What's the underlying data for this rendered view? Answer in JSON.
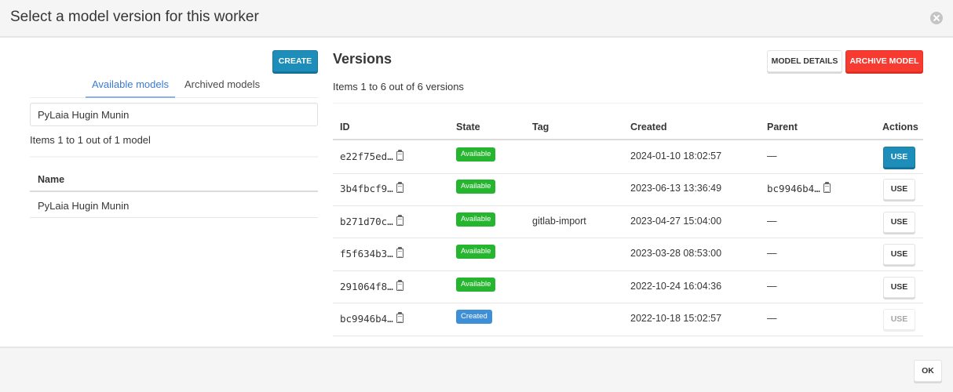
{
  "modal": {
    "title": "Select a model version for this worker",
    "close_icon": "close-circle-icon",
    "ok_label": "OK"
  },
  "left": {
    "create_label": "CREATE",
    "tabs": [
      {
        "label": "Available models",
        "active": true
      },
      {
        "label": "Archived models",
        "active": false
      }
    ],
    "search": {
      "value": "PyLaia Hugin Munin",
      "placeholder": ""
    },
    "count_text": "Items 1 to 1 out of 1 model",
    "table": {
      "header": "Name",
      "rows": [
        {
          "name": "PyLaia Hugin Munin"
        }
      ]
    }
  },
  "right": {
    "title": "Versions",
    "model_details_label": "MODEL DETAILS",
    "archive_model_label": "ARCHIVE MODEL",
    "count_text": "Items 1 to 6 out of 6 versions",
    "columns": [
      "ID",
      "State",
      "Tag",
      "Created",
      "Parent",
      "Actions"
    ],
    "rows": [
      {
        "id": "e22f75ed…",
        "state": "Available",
        "tag": "",
        "created": "2024-01-10 18:02:57",
        "parent": "—",
        "parent_copyable": false,
        "action": "USE",
        "action_style": "primary"
      },
      {
        "id": "3b4fbcf9…",
        "state": "Available",
        "tag": "",
        "created": "2023-06-13 13:36:49",
        "parent": "bc9946b4…",
        "parent_copyable": true,
        "action": "USE",
        "action_style": "default"
      },
      {
        "id": "b271d70c…",
        "state": "Available",
        "tag": "gitlab-import",
        "created": "2023-04-27 15:04:00",
        "parent": "—",
        "parent_copyable": false,
        "action": "USE",
        "action_style": "default"
      },
      {
        "id": "f5f634b3…",
        "state": "Available",
        "tag": "",
        "created": "2023-03-28 08:53:00",
        "parent": "—",
        "parent_copyable": false,
        "action": "USE",
        "action_style": "default"
      },
      {
        "id": "291064f8…",
        "state": "Available",
        "tag": "",
        "created": "2022-10-24 16:04:36",
        "parent": "—",
        "parent_copyable": false,
        "action": "USE",
        "action_style": "default"
      },
      {
        "id": "bc9946b4…",
        "state": "Created",
        "tag": "",
        "created": "2022-10-18 15:02:57",
        "parent": "—",
        "parent_copyable": false,
        "action": "USE",
        "action_style": "disabled"
      }
    ]
  },
  "colors": {
    "primary": "#1d8dba",
    "danger": "#f83b31",
    "available": "#26b52f",
    "created": "#3f8fd6",
    "tab_active": "#3a7ad5"
  }
}
